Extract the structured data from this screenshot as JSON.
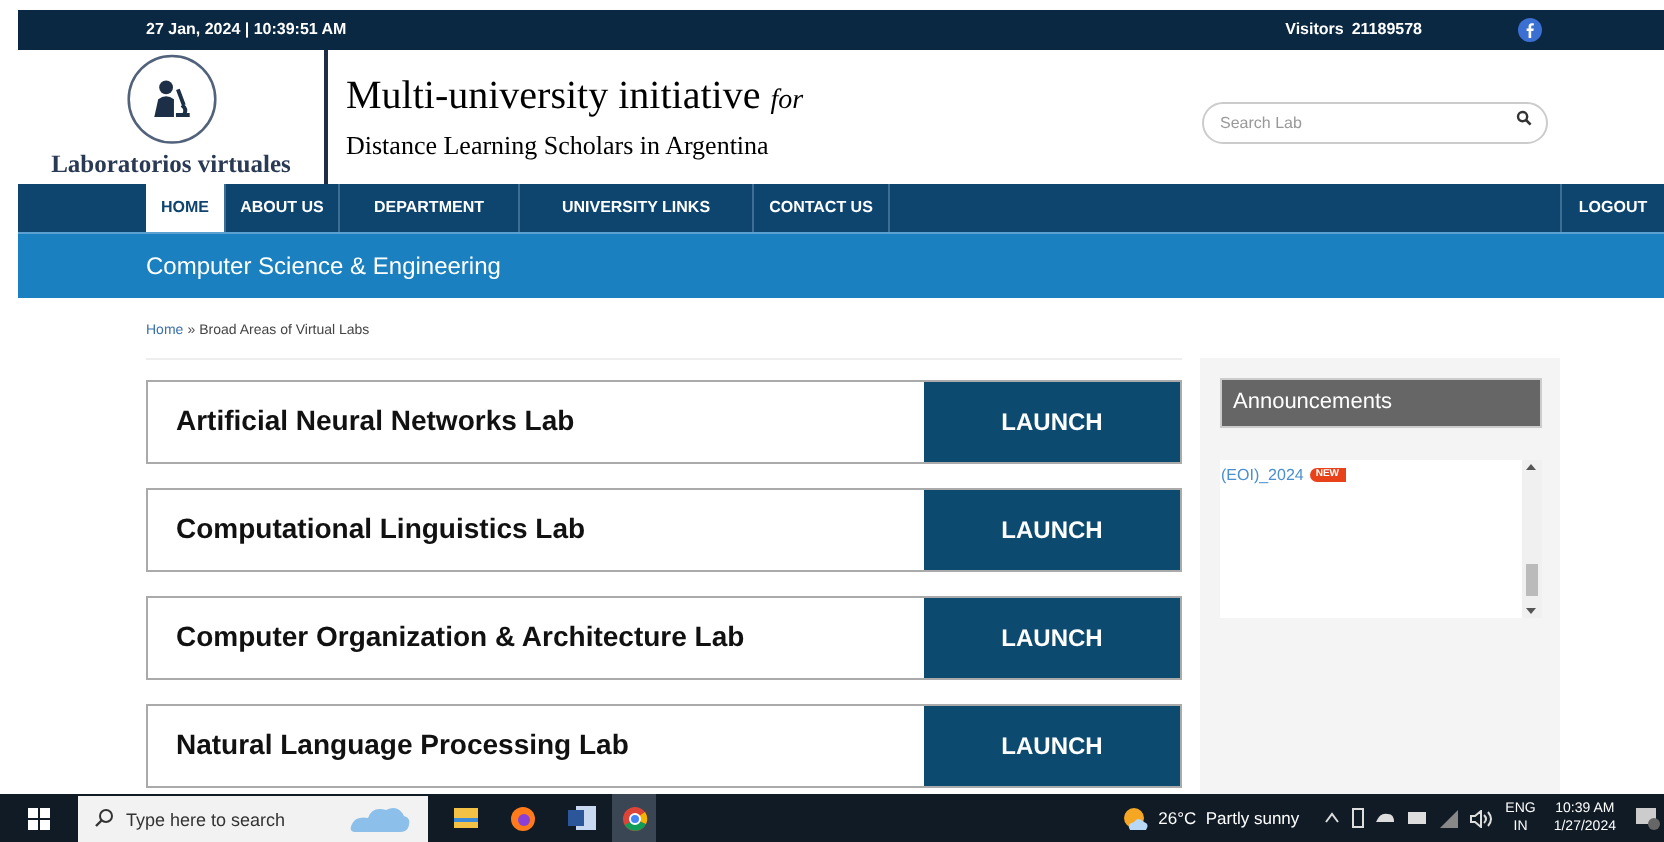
{
  "top_bar": {
    "datetime": "27 Jan, 2024 | 10:39:51 AM",
    "visitors_label": "Visitors",
    "visitors_count": "21189578"
  },
  "header": {
    "logo_text": "Laboratorios virtuales",
    "title": "Multi-university initiative",
    "title_suffix": "for",
    "subtitle": "Distance Learning Scholars in Argentina",
    "search": {
      "placeholder": "Search Lab"
    }
  },
  "nav": {
    "items": [
      {
        "label": "HOME",
        "selected": true
      },
      {
        "label": "ABOUT US",
        "selected": false
      },
      {
        "label": "DEPARTMENT",
        "selected": false
      },
      {
        "label": "UNIVERSITY LINKS",
        "selected": false
      },
      {
        "label": "CONTACT US",
        "selected": false
      }
    ],
    "logout": "LOGOUT"
  },
  "banner": {
    "title": "Computer Science & Engineering"
  },
  "breadcrumb": {
    "home": "Home",
    "separator": "»",
    "current": "Broad Areas of Virtual Labs"
  },
  "labs": [
    {
      "name": "Artificial Neural Networks Lab",
      "button": "LAUNCH"
    },
    {
      "name": "Computational Linguistics Lab",
      "button": "LAUNCH"
    },
    {
      "name": "Computer Organization & Architecture Lab",
      "button": "LAUNCH"
    },
    {
      "name": "Natural Language Processing Lab",
      "button": "LAUNCH"
    }
  ],
  "announcements": {
    "title": "Announcements",
    "items": [
      {
        "text": "(EOI)_2024",
        "badge": "NEW"
      }
    ]
  },
  "taskbar": {
    "search": {
      "placeholder": "Type here to search"
    },
    "weather": "26°C  Partly sunny",
    "language": "ENG",
    "region": "IN",
    "time": "10:39 AM",
    "date": "1/27/2024"
  }
}
